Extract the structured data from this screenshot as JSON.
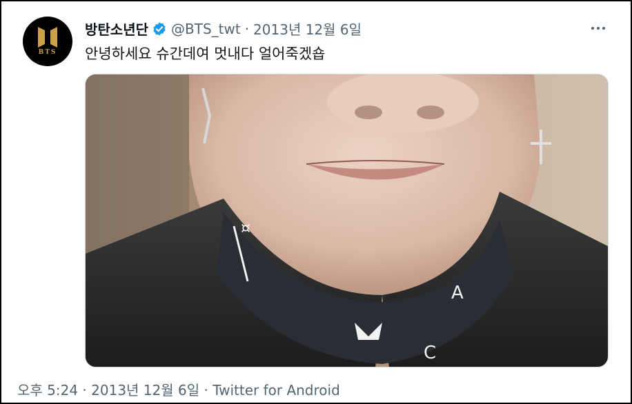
{
  "account": {
    "avatar_text": "BTS",
    "display_name": "방탄소년단",
    "verified_icon": "verified-badge-icon",
    "handle": "@BTS_twt",
    "separator": "·",
    "date": "2013년 12월 6일"
  },
  "tweet": {
    "text": "안녕하세요 슈간데여 멋내다 얼어죽겠숍",
    "media_icon": "photo"
  },
  "footer": {
    "timestamp": "오후 5:24 · 2013년 12월 6일 · Twitter for Android"
  },
  "colors": {
    "secondary_text": "#536471",
    "primary_text": "#0f1419",
    "verified_blue": "#1d9bf0",
    "avatar_gold": "#c9a24a"
  }
}
